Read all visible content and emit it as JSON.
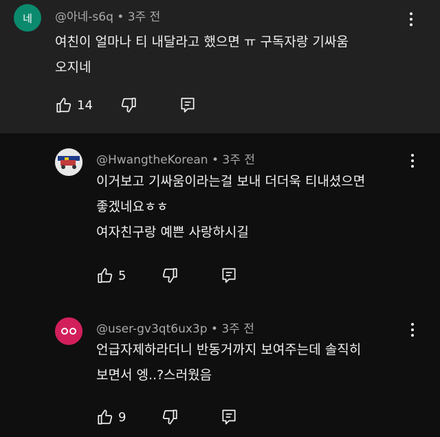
{
  "comments": [
    {
      "avatar_text": "네",
      "meta": "@아네-s6q • 3주 전",
      "lines": [
        "여친이 얼마나 티 내달라고 했으면 ㅠ 구독자랑 기싸움",
        "오지네"
      ],
      "likes": "14",
      "avatar_color": "#0b8a6e"
    },
    {
      "meta": "@HwangtheKorean • 3주 전",
      "lines": [
        "이거보고 기싸움이라는걸 보내 더더욱 티내셨으면",
        "좋겠네요ㅎㅎ",
        "여자친구랑 예쁜 사랑하시길"
      ],
      "likes": "5"
    },
    {
      "meta": "@user-gv3qt6ux3p • 3주 전",
      "lines": [
        "언급자제하라더니 반동거까지 보여주는데 솔직히",
        "보면서 엥..?스러웠음"
      ],
      "likes": "9",
      "avatar_color": "#d21f5c"
    }
  ],
  "colors": {
    "background": "#0f0f0f",
    "highlight_bg": "#212121",
    "meta_text": "#aaaaaa",
    "text": "#f1f1f1"
  },
  "icons": [
    "thumbs-up-icon",
    "thumbs-down-icon",
    "reply-icon",
    "more-vert-icon"
  ]
}
